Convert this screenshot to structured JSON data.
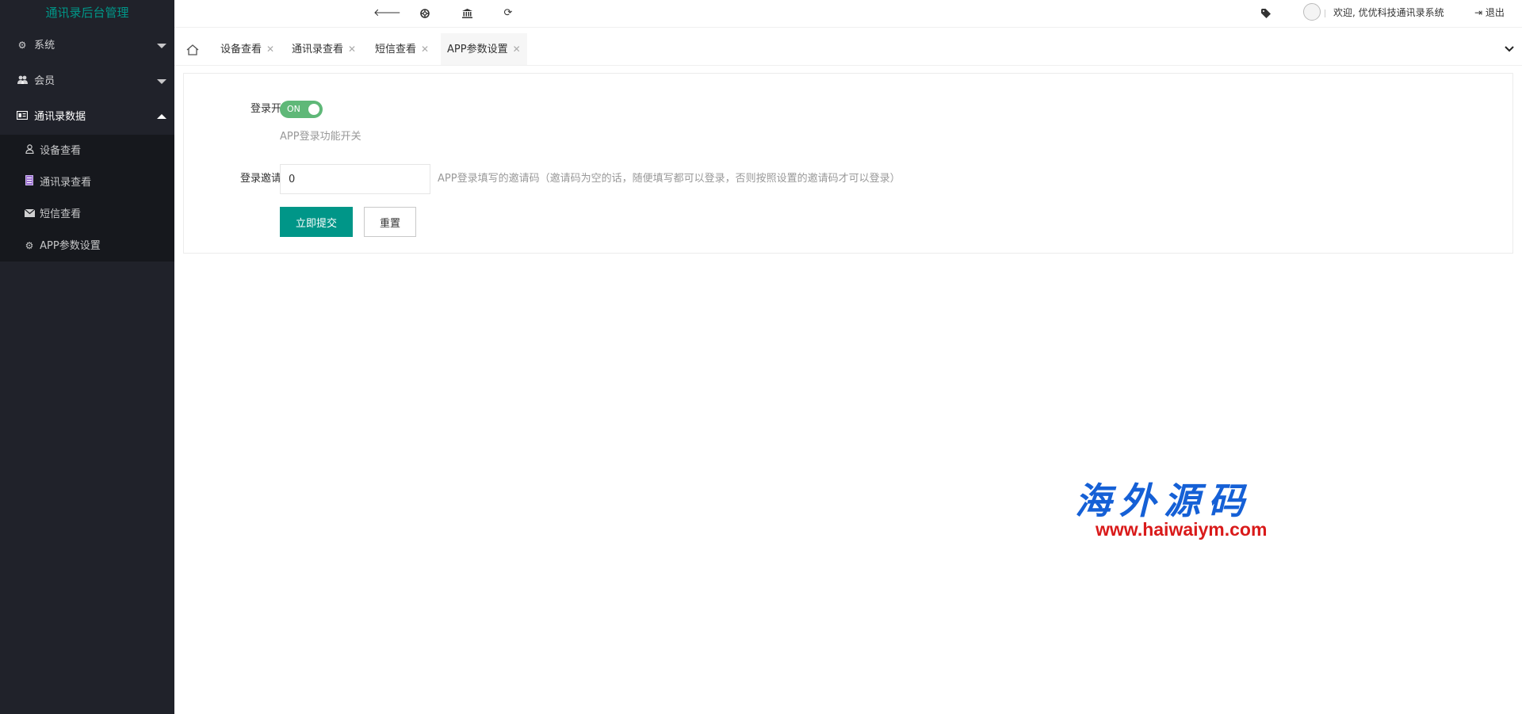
{
  "app": {
    "title": "通讯录后台管理"
  },
  "colors": {
    "sidebar_bg": "#20222a",
    "accent": "#009688",
    "switch_on": "#5FB878",
    "watermark_blue": "#1560d6",
    "watermark_red": "#d91a1a"
  },
  "sidebar": {
    "groups": [
      {
        "label": "系统",
        "icon": "gear-icon",
        "expanded": false
      },
      {
        "label": "会员",
        "icon": "users-icon",
        "expanded": false
      },
      {
        "label": "通讯录数据",
        "icon": "id-card-icon",
        "expanded": true
      }
    ],
    "sub_items": [
      {
        "label": "设备查看",
        "icon": "user-icon"
      },
      {
        "label": "通讯录查看",
        "icon": "address-book-icon"
      },
      {
        "label": "短信查看",
        "icon": "envelope-icon"
      },
      {
        "label": "APP参数设置",
        "icon": "gear-icon"
      }
    ]
  },
  "header": {
    "icons": [
      "back-arrow-icon",
      "support-icon",
      "bank-icon",
      "refresh-icon",
      "tag-icon"
    ],
    "welcome": "欢迎, 优优科技通讯录系统",
    "logout": "退出"
  },
  "tabs": {
    "items": [
      {
        "label": "设备查看"
      },
      {
        "label": "通讯录查看"
      },
      {
        "label": "短信查看"
      },
      {
        "label": "APP参数设置",
        "active": true
      }
    ],
    "close_glyph": "✕"
  },
  "form": {
    "login_switch": {
      "label": "登录开关",
      "state_text": "ON",
      "on": true,
      "help": "APP登录功能开关"
    },
    "invite_code": {
      "label": "登录邀请码",
      "value": "0",
      "help": "APP登录填写的邀请码（邀请码为空的话，随便填写都可以登录，否则按照设置的邀请码才可以登录）"
    },
    "submit_label": "立即提交",
    "reset_label": "重置"
  },
  "watermark": {
    "chinese": "海外源码",
    "url": "www.haiwaiym.com"
  }
}
